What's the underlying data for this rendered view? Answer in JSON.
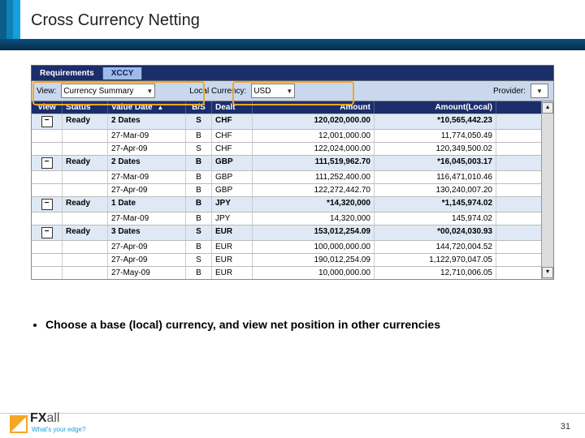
{
  "slide": {
    "title": "Cross Currency Netting",
    "page_number": "31",
    "bullet": "Choose a base (local) currency, and view net position in other currencies"
  },
  "brand": {
    "name_a": "FX",
    "name_b": "all",
    "tagline": "What's your edge?"
  },
  "app": {
    "tabs": {
      "item0": "Requirements",
      "item1": "XCCY"
    },
    "filters": {
      "view_lbl": "View:",
      "view_val": "Currency Summary",
      "local_lbl": "Local Currency:",
      "local_val": "USD",
      "provider_lbl": "Provider:"
    },
    "headers": {
      "view": "View",
      "status": "Status",
      "date": "Value Date",
      "bs": "B/S",
      "dealt": "Dealt",
      "amount": "Amount",
      "amountl": "Amount(Local)"
    },
    "rows": [
      {
        "type": "group",
        "exp": "−",
        "status": "Ready",
        "date": "2 Dates",
        "bs": "S",
        "dealt": "CHF",
        "amt": "120,020,000.00",
        "amtl": "*10,565,442.23"
      },
      {
        "type": "detail",
        "date": "27-Mar-09",
        "bs": "B",
        "dealt": "CHF",
        "amt": "12,001,000.00",
        "amtl": "11,774,050.49"
      },
      {
        "type": "detail",
        "date": "27-Apr-09",
        "bs": "S",
        "dealt": "CHF",
        "amt": "122,024,000.00",
        "amtl": "120,349,500.02"
      },
      {
        "type": "group",
        "exp": "−",
        "status": "Ready",
        "date": "2 Dates",
        "bs": "B",
        "dealt": "GBP",
        "amt": "111,519,962.70",
        "amtl": "*16,045,003.17"
      },
      {
        "type": "detail",
        "date": "27-Mar-09",
        "bs": "B",
        "dealt": "GBP",
        "amt": "111,252,400.00",
        "amtl": "116,471,010.46"
      },
      {
        "type": "detail",
        "date": "27-Apr-09",
        "bs": "B",
        "dealt": "GBP",
        "amt": "122,272,442.70",
        "amtl": "130,240,007.20"
      },
      {
        "type": "group",
        "exp": "−",
        "status": "Ready",
        "date": "1 Date",
        "bs": "B",
        "dealt": "JPY",
        "amt": "*14,320,000",
        "amtl": "*1,145,974.02"
      },
      {
        "type": "detail",
        "date": "27-Mar-09",
        "bs": "B",
        "dealt": "JPY",
        "amt": "14,320,000",
        "amtl": "145,974.02"
      },
      {
        "type": "group",
        "exp": "−",
        "status": "Ready",
        "date": "3 Dates",
        "bs": "S",
        "dealt": "EUR",
        "amt": "153,012,254.09",
        "amtl": "*00,024,030.93"
      },
      {
        "type": "detail",
        "date": "27-Apr-09",
        "bs": "B",
        "dealt": "EUR",
        "amt": "100,000,000.00",
        "amtl": "144,720,004.52"
      },
      {
        "type": "detail",
        "date": "27-Apr-09",
        "bs": "S",
        "dealt": "EUR",
        "amt": "190,012,254.09",
        "amtl": "1,122,970,047.05"
      },
      {
        "type": "detail",
        "date": "27-May-09",
        "bs": "B",
        "dealt": "EUR",
        "amt": "10,000,000.00",
        "amtl": "12,710,006.05"
      }
    ]
  }
}
